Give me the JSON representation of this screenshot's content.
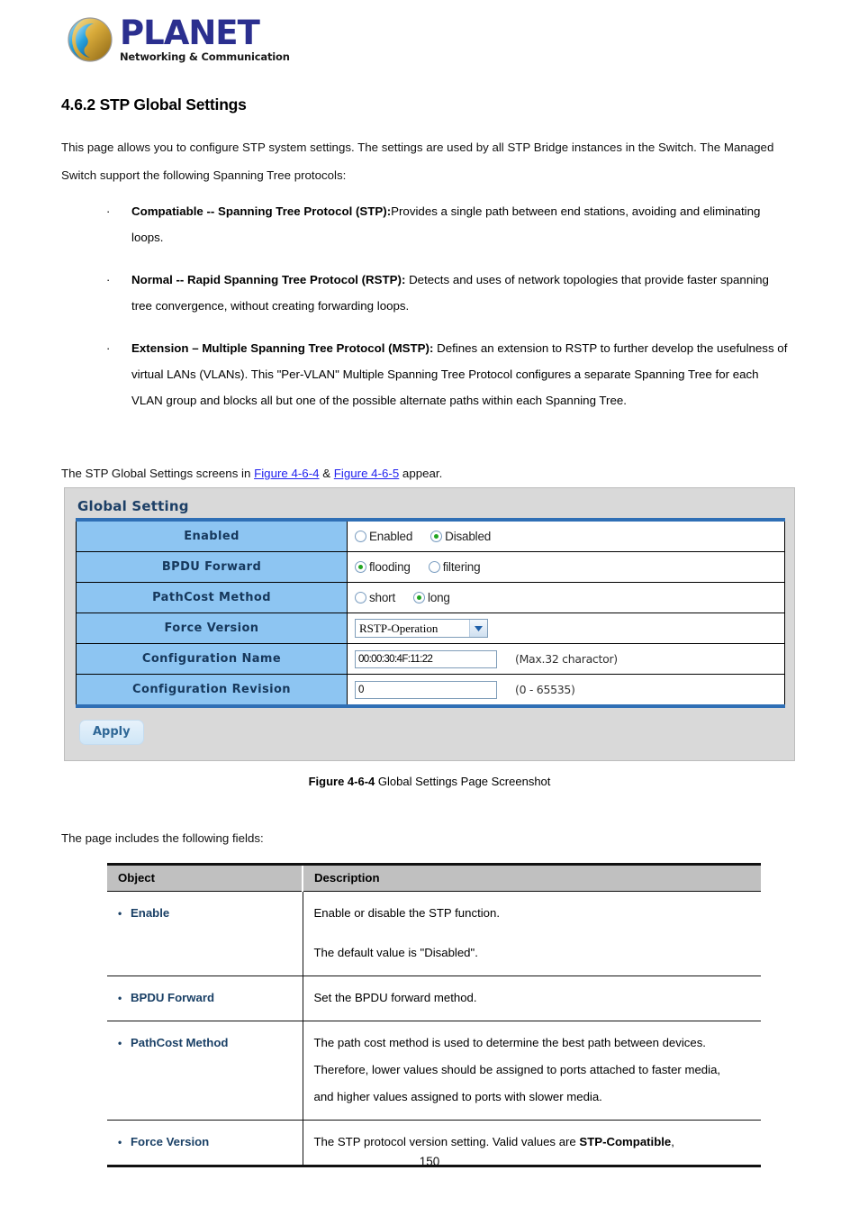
{
  "brand": {
    "name": "PLANET",
    "tagline": "Networking & Communication",
    "logo_icon": "planet-globe-icon",
    "word_color": "#2b2f8f"
  },
  "section": {
    "heading": "4.6.2 STP Global Settings",
    "intro": "This page allows you to configure STP system settings. The settings are used by all STP Bridge instances in the Switch. The Managed Switch support the following Spanning Tree protocols:"
  },
  "protocols": [
    {
      "bullet": "·",
      "title": "Compatiable -- Spanning Tree Protocol (STP):",
      "text": "Provides a single path between end stations, avoiding and eliminating loops."
    },
    {
      "bullet": "·",
      "title": "Normal -- Rapid Spanning Tree Protocol (RSTP):",
      "text": " Detects and uses of network topologies that provide faster spanning tree convergence, without creating forwarding loops."
    },
    {
      "bullet": "·",
      "title": "Extension – Multiple Spanning Tree Protocol (MSTP):",
      "text": " Defines an extension to RSTP to further develop the usefulness of virtual LANs (VLANs). This \"Per-VLAN\" Multiple Spanning Tree Protocol configures a separate Spanning Tree for each VLAN group and blocks all but one of the possible alternate paths within each Spanning Tree."
    }
  ],
  "figure_ref": {
    "prefix": "The STP Global Settings screens in ",
    "link1": "Figure 4-6-4",
    "conjunction": " & ",
    "link2": "Figure 4-6-5",
    "suffix": " appear.",
    "link_color": "#2222ee"
  },
  "screenshot": {
    "panel_title": "Global Setting",
    "accent_color": "#2f6fb5",
    "label_bg": "#8dc5f2",
    "rows": [
      {
        "label": "Enabled",
        "type": "radio",
        "options": [
          {
            "label": "Enabled",
            "selected": false
          },
          {
            "label": "Disabled",
            "selected": true
          }
        ]
      },
      {
        "label": "BPDU Forward",
        "type": "radio",
        "options": [
          {
            "label": "flooding",
            "selected": true
          },
          {
            "label": "filtering",
            "selected": false
          }
        ]
      },
      {
        "label": "PathCost Method",
        "type": "radio",
        "options": [
          {
            "label": "short",
            "selected": false
          },
          {
            "label": "long",
            "selected": true
          }
        ]
      },
      {
        "label": "Force Version",
        "type": "select",
        "value": "RSTP-Operation"
      },
      {
        "label": "Configuration Name",
        "type": "text",
        "value": "00:00:30:4F:11:22",
        "hint": "(Max.32 charactor)"
      },
      {
        "label": "Configuration Revision",
        "type": "text",
        "value": "0",
        "hint": "(0 - 65535)"
      }
    ],
    "apply_label": "Apply"
  },
  "figure_caption": {
    "label": "Figure 4-6-4",
    "text": " Global Settings Page Screenshot"
  },
  "fields_intro": "The page includes the following fields:",
  "desc_table": {
    "headers": {
      "object": "Object",
      "description": "Description"
    },
    "rows": [
      {
        "object": "Enable",
        "lines": [
          "Enable or disable the STP function.",
          "",
          "The default value is \"Disabled\"."
        ]
      },
      {
        "object": "BPDU Forward",
        "lines": [
          "Set the BPDU forward method."
        ]
      },
      {
        "object": "PathCost Method",
        "lines": [
          "The path cost method is used to determine the best path between devices.",
          "Therefore, lower values should be assigned to ports attached to faster media,",
          "and higher values assigned to ports with slower media."
        ]
      },
      {
        "object": "Force Version",
        "lines_html": [
          "The STP protocol version setting. Valid values are <b>STP-Compatible</b>,"
        ]
      }
    ]
  },
  "page_number": "150"
}
